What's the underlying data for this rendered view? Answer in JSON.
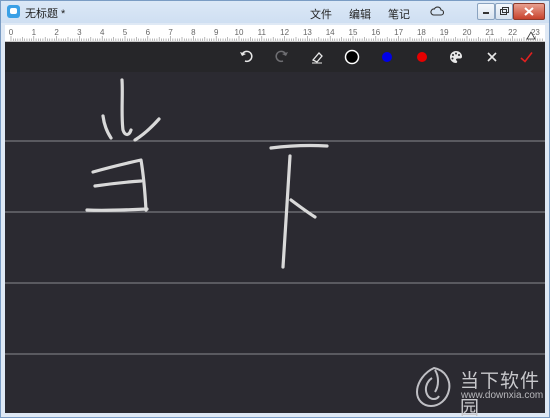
{
  "window": {
    "title": "无标题 *"
  },
  "menu": {
    "items": [
      "文件",
      "编辑",
      "笔记"
    ],
    "cloud_icon": "cloud-icon"
  },
  "window_controls": {
    "icons": [
      "minimize-icon",
      "restore-icon",
      "close-icon"
    ]
  },
  "ruler": {
    "labels": [
      "0",
      "1",
      "2",
      "3",
      "4",
      "5",
      "6",
      "7",
      "8",
      "9",
      "10",
      "11",
      "12",
      "13",
      "14",
      "15",
      "16",
      "17",
      "18",
      "19",
      "20",
      "21",
      "22",
      "23"
    ]
  },
  "toolbar": {
    "tools": [
      {
        "name": "undo-icon"
      },
      {
        "name": "redo-icon"
      },
      {
        "name": "eraser-icon"
      },
      {
        "name": "color-black",
        "color": "#000000"
      },
      {
        "name": "color-blue",
        "color": "#0000e6"
      },
      {
        "name": "color-red",
        "color": "#e60000"
      },
      {
        "name": "palette-icon"
      },
      {
        "name": "cancel-icon"
      },
      {
        "name": "confirm-icon",
        "color": "#e02020"
      }
    ]
  },
  "canvas": {
    "background": "#2b2a31",
    "line_color": "#8a8a8e",
    "stroke_color": "#d9d9d9"
  },
  "watermark": {
    "text": "当下软件园",
    "url": "www.downxia.com"
  }
}
